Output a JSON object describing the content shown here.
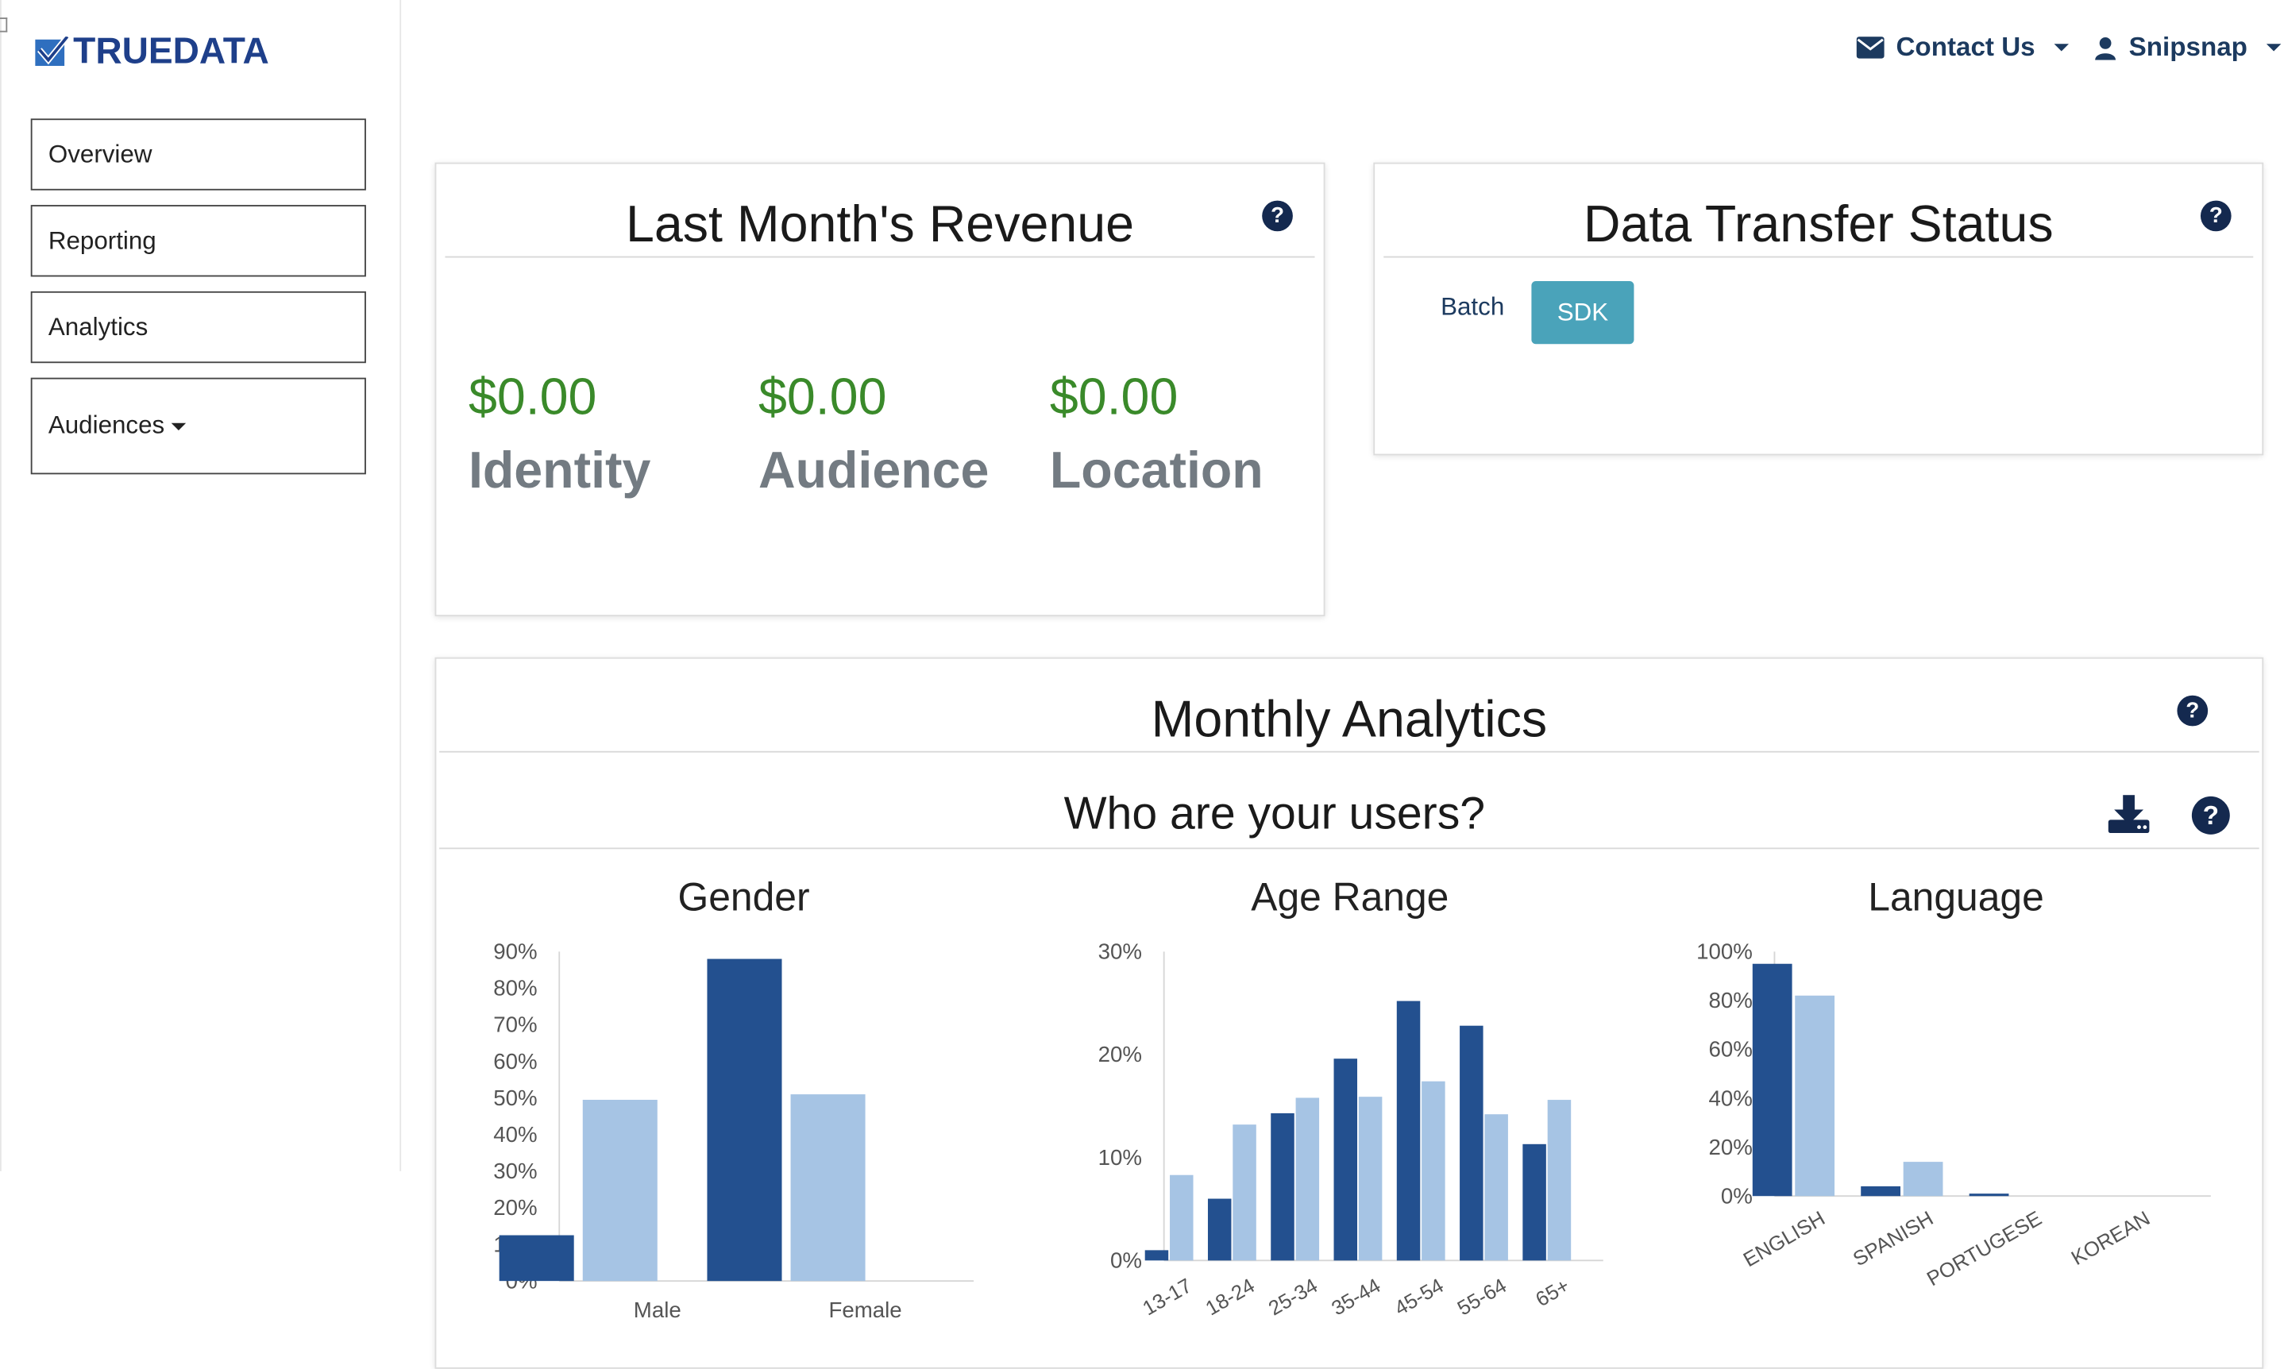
{
  "brand": {
    "name": "TRUEDATA"
  },
  "sidebar": {
    "items": [
      {
        "label": "Overview"
      },
      {
        "label": "Reporting"
      },
      {
        "label": "Analytics"
      },
      {
        "label": "Audiences",
        "has_dropdown": true
      }
    ]
  },
  "header": {
    "contact_label": "Contact Us",
    "user_label": "Snipsnap"
  },
  "revenue_card": {
    "title": "Last Month's Revenue",
    "items": [
      {
        "amount": "$0.00",
        "label": "Identity"
      },
      {
        "amount": "$0.00",
        "label": "Audience"
      },
      {
        "amount": "$0.00",
        "label": "Location"
      }
    ]
  },
  "transfer_card": {
    "title": "Data Transfer Status",
    "tabs": [
      {
        "label": "Batch",
        "active": false
      },
      {
        "label": "SDK",
        "active": true
      }
    ]
  },
  "analytics_card": {
    "title": "Monthly Analytics",
    "subtitle": "Who are your users?"
  },
  "colors": {
    "series_dark": "#23508f",
    "series_light": "#a6c4e4",
    "accent": "#4aa3ba",
    "money": "#3a8a2a",
    "nav_text": "#1c3a5f"
  },
  "chart_data": [
    {
      "type": "bar",
      "title": "Gender",
      "categories": [
        "Male",
        "Female"
      ],
      "series": [
        {
          "values": [
            12.5,
            88
          ],
          "color": "#23508f"
        },
        {
          "values": [
            49.5,
            51
          ],
          "color": "#a6c4e4"
        }
      ],
      "yticks": [
        "0%",
        "10%",
        "20%",
        "30%",
        "40%",
        "50%",
        "60%",
        "70%",
        "80%",
        "90%"
      ],
      "ylim": [
        0,
        90
      ],
      "grid": false,
      "legend": "none"
    },
    {
      "type": "bar",
      "title": "Age Range",
      "categories": [
        "13-17",
        "18-24",
        "25-34",
        "35-44",
        "45-54",
        "55-64",
        "65+"
      ],
      "series": [
        {
          "values": [
            1,
            6,
            14.3,
            19.6,
            25.2,
            22.8,
            11.3
          ],
          "color": "#23508f"
        },
        {
          "values": [
            8.3,
            13.2,
            15.8,
            15.9,
            17.4,
            14.2,
            15.6
          ],
          "color": "#a6c4e4"
        }
      ],
      "yticks": [
        "0%",
        "10%",
        "20%",
        "30%"
      ],
      "ylim": [
        0,
        30
      ],
      "grid": false,
      "legend": "none"
    },
    {
      "type": "bar",
      "title": "Language",
      "categories": [
        "ENGLISH",
        "SPANISH",
        "PORTUGESE",
        "KOREAN"
      ],
      "series": [
        {
          "values": [
            95,
            4,
            1,
            0
          ],
          "color": "#23508f"
        },
        {
          "values": [
            82,
            14,
            0,
            0
          ],
          "color": "#a6c4e4"
        }
      ],
      "yticks": [
        "0%",
        "20%",
        "40%",
        "60%",
        "80%",
        "100%"
      ],
      "ylim": [
        0,
        100
      ],
      "grid": false,
      "legend": "none"
    }
  ]
}
